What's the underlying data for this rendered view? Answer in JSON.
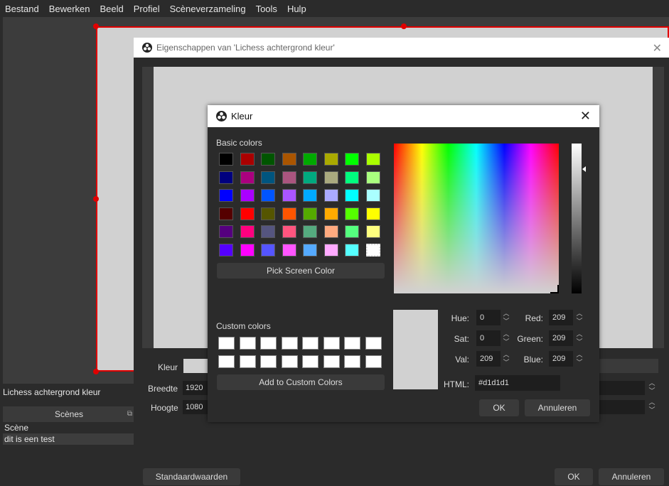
{
  "menubar": {
    "items": [
      "Bestand",
      "Bewerken",
      "Beeld",
      "Profiel",
      "Scèneverzameling",
      "Tools",
      "Hulp"
    ]
  },
  "main": {
    "source_name": "Lichess achtergrond kleur",
    "scenes_header": "Scènes",
    "scenes": [
      "Scène",
      "dit is een test"
    ]
  },
  "properties": {
    "title": "Eigenschappen van 'Lichess achtergrond kleur'",
    "color_label": "Kleur",
    "width_label": "Breedte",
    "width_value": "1920",
    "height_label": "Hoogte",
    "height_value": "1080",
    "defaults_button": "Standaardwaarden",
    "ok_button": "OK",
    "cancel_button": "Annuleren"
  },
  "color_dialog": {
    "title": "Kleur",
    "basic_colors_label": "Basic colors",
    "basic_colors": [
      [
        "#000000",
        "#aa0000",
        "#005500",
        "#aa5500",
        "#00aa00",
        "#aaaa00",
        "#00ff00",
        "#aaff00"
      ],
      [
        "#00007f",
        "#aa007f",
        "#00557f",
        "#aa557f",
        "#00aa7f",
        "#aaaa7f",
        "#00ff7f",
        "#aaff7f"
      ],
      [
        "#0000ff",
        "#aa00ff",
        "#0055ff",
        "#aa55ff",
        "#00aaff",
        "#aaaaff",
        "#00ffff",
        "#aaffff"
      ],
      [
        "#550000",
        "#ff0000",
        "#555500",
        "#ff5500",
        "#55aa00",
        "#ffaa00",
        "#55ff00",
        "#ffff00"
      ],
      [
        "#55007f",
        "#ff007f",
        "#55557f",
        "#ff557f",
        "#55aa7f",
        "#ffaa7f",
        "#55ff7f",
        "#ffff7f"
      ],
      [
        "#5500ff",
        "#ff00ff",
        "#5555ff",
        "#ff55ff",
        "#55aaff",
        "#ffaaff",
        "#55ffff",
        "#ffffff"
      ]
    ],
    "pick_screen_color": "Pick Screen Color",
    "custom_colors_label": "Custom colors",
    "add_custom_colors": "Add to Custom Colors",
    "hue_label": "Hue:",
    "hue": "0",
    "sat_label": "Sat:",
    "sat": "0",
    "val_label": "Val:",
    "val": "209",
    "red_label": "Red:",
    "red": "209",
    "green_label": "Green:",
    "green": "209",
    "blue_label": "Blue:",
    "blue": "209",
    "html_label": "HTML:",
    "html": "#d1d1d1",
    "ok_button": "OK",
    "cancel_button": "Annuleren",
    "current_color": "#d1d1d1"
  },
  "icons": [
    "obs-logo-icon",
    "close-icon",
    "chevron-up-icon",
    "chevron-down-icon",
    "dock-icon"
  ]
}
